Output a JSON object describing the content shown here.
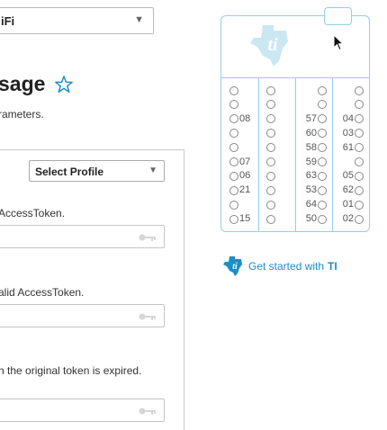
{
  "top_select": {
    "value": "iFi"
  },
  "heading": {
    "title": "sage"
  },
  "subtitle": "rameters.",
  "profile_select": {
    "value": "Select Profile"
  },
  "fields": [
    {
      "label": "AccessToken."
    },
    {
      "label": "alid AccessToken."
    },
    {
      "label": "n the original token is expired."
    }
  ],
  "board": {
    "col1": [
      "",
      "",
      "08",
      "",
      "",
      "07",
      "06",
      "21",
      "",
      "15"
    ],
    "col2": [
      "",
      "",
      "",
      "",
      "",
      "",
      "",
      "",
      "",
      ""
    ],
    "col3": [
      "",
      "",
      "57",
      "60",
      "58",
      "59",
      "63",
      "53",
      "64",
      "50"
    ],
    "col4": [
      "",
      "",
      "04",
      "03",
      "61",
      "",
      "05",
      "62",
      "01",
      "02"
    ]
  },
  "get_started": {
    "text": "Get started with",
    "brand": "TI"
  },
  "colors": {
    "accent": "#1b8fc6",
    "board_border": "#8fd1e3"
  },
  "icons": [
    "chevron-down-icon",
    "star-icon",
    "key-icon",
    "ti-logo-icon",
    "mouse-cursor-icon"
  ]
}
